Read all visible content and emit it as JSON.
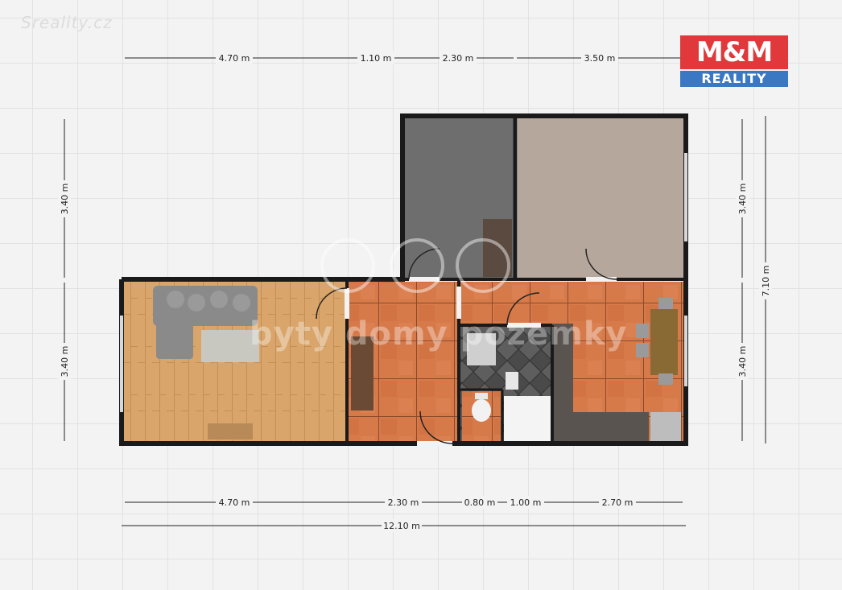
{
  "watermark_top": "Sreality.cz",
  "logo": {
    "line1": "M&M",
    "line2": "REALITY",
    "red": "#e1393b",
    "blue": "#3a78c4"
  },
  "watermark_center": "byty domy pozemky",
  "dimensions": {
    "top": [
      "4.70 m",
      "1.10 m",
      "2.30 m",
      "3.50 m"
    ],
    "bottom": [
      "4.70 m",
      "2.30 m",
      "0.80 m",
      "1.00 m",
      "2.70 m"
    ],
    "total_width": "12.10 m",
    "left": [
      "3.40 m",
      "3.40 m"
    ],
    "right": [
      "3.40 m",
      "3.40 m"
    ],
    "total_height": "7.10 m"
  }
}
